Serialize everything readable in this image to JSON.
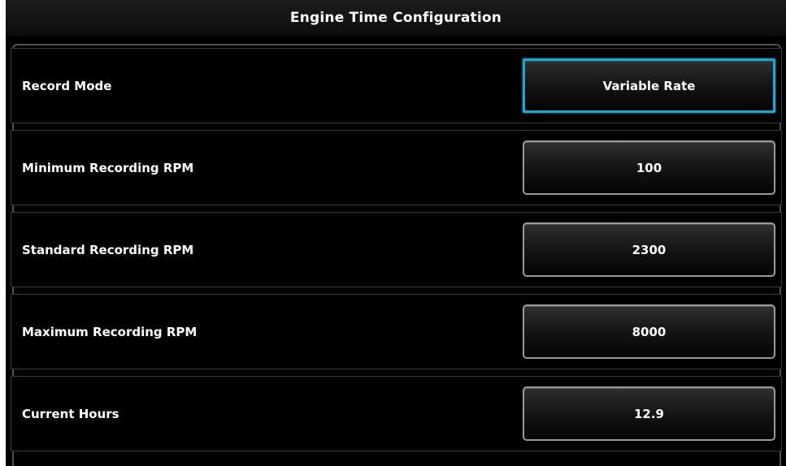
{
  "title": "Engine Time Configuration",
  "accent_color": "#1fa7d0",
  "rows": [
    {
      "label": "Record Mode",
      "value": "Variable Rate",
      "selected": true
    },
    {
      "label": "Minimum Recording RPM",
      "value": "100",
      "selected": false
    },
    {
      "label": "Standard Recording RPM",
      "value": "2300",
      "selected": false
    },
    {
      "label": "Maximum Recording RPM",
      "value": "8000",
      "selected": false
    },
    {
      "label": "Current Hours",
      "value": "12.9",
      "selected": false
    }
  ]
}
